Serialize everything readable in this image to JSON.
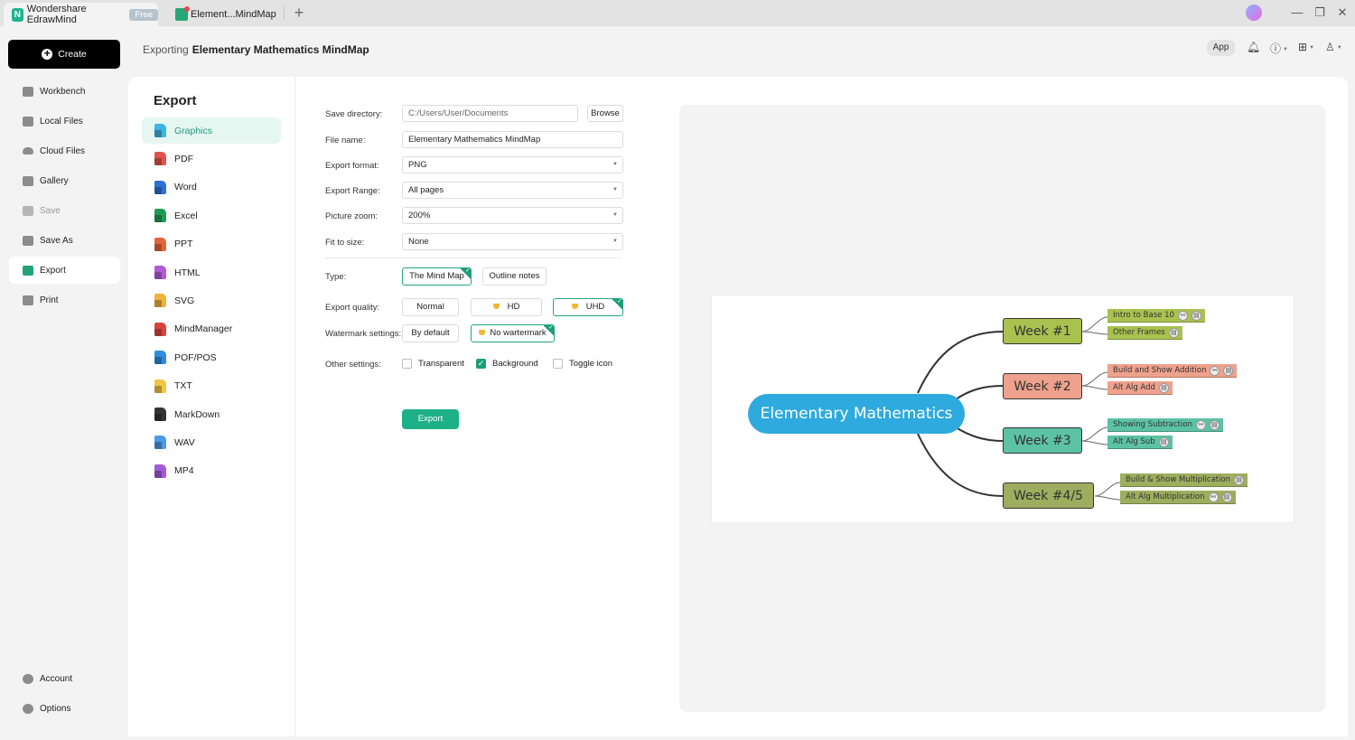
{
  "titlebar": {
    "app_tab": "Wondershare EdrawMind",
    "app_badge": "Free",
    "doc_tab": "Element...MindMap",
    "new_tab_icon": "+",
    "minimize": "—",
    "restore": "❐",
    "close": "✕"
  },
  "sidebar": {
    "create_label": "Create",
    "items": [
      {
        "label": "Workbench",
        "icon": "workbench-icon"
      },
      {
        "label": "Local Files",
        "icon": "folder-icon"
      },
      {
        "label": "Cloud Files",
        "icon": "cloud-icon"
      },
      {
        "label": "Gallery",
        "icon": "gallery-icon"
      },
      {
        "label": "Save",
        "icon": "save-icon"
      },
      {
        "label": "Save As",
        "icon": "save-as-icon"
      },
      {
        "label": "Export",
        "icon": "export-icon"
      },
      {
        "label": "Print",
        "icon": "print-icon"
      }
    ],
    "bottom": [
      {
        "label": "Account",
        "icon": "account-icon"
      },
      {
        "label": "Options",
        "icon": "gear-icon"
      }
    ]
  },
  "header": {
    "prefix": "Exporting",
    "doc_title": "Elementary Mathematics MindMap",
    "app_button": "App",
    "bell": "🔔",
    "help": "?",
    "apps": "⊞",
    "shirt": "👕"
  },
  "export_panel": {
    "heading": "Export",
    "formats": [
      {
        "label": "Graphics",
        "color": "#3db5e0",
        "glyph": ""
      },
      {
        "label": "PDF",
        "color": "#e0534a",
        "glyph": ""
      },
      {
        "label": "Word",
        "color": "#2f6fd1",
        "glyph": "W"
      },
      {
        "label": "Excel",
        "color": "#1f9a54",
        "glyph": "S"
      },
      {
        "label": "PPT",
        "color": "#e3653a",
        "glyph": "P"
      },
      {
        "label": "HTML",
        "color": "#b05ad6",
        "glyph": "H"
      },
      {
        "label": "SVG",
        "color": "#f0b23d",
        "glyph": "S"
      },
      {
        "label": "MindManager",
        "color": "#d6453d",
        "glyph": "M"
      },
      {
        "label": "POF/POS",
        "color": "#2f8be0",
        "glyph": "P"
      },
      {
        "label": "TXT",
        "color": "#f2c542",
        "glyph": ""
      },
      {
        "label": "MarkDown",
        "color": "#333333",
        "glyph": ""
      },
      {
        "label": "WAV",
        "color": "#4a9ae8",
        "glyph": ""
      },
      {
        "label": "MP4",
        "color": "#a15ad9",
        "glyph": ""
      }
    ]
  },
  "form": {
    "save_directory": {
      "label": "Save directory:",
      "value": "C:/Users/User/Documents",
      "browse": "Browse"
    },
    "file_name": {
      "label": "File name:",
      "value": "Elementary Mathematics MindMap"
    },
    "export_format": {
      "label": "Export format:",
      "value": "PNG"
    },
    "export_range": {
      "label": "Export Range:",
      "value": "All pages"
    },
    "picture_zoom": {
      "label": "Picture zoom:",
      "value": "200%"
    },
    "fit_to_size": {
      "label": "Fit to size:",
      "value": "None"
    },
    "type": {
      "label": "Type:",
      "options": [
        "The Mind Map",
        "Outline notes"
      ],
      "selected": "The Mind Map"
    },
    "quality": {
      "label": "Export quality:",
      "options": [
        "Normal",
        "HD",
        "UHD"
      ],
      "selected": "UHD"
    },
    "watermark": {
      "label": "Watermark settings:",
      "options": [
        "By default",
        "No wartermark"
      ],
      "selected": "No wartermark"
    },
    "other": {
      "label": "Other settings:",
      "transparent": "Transparent",
      "background": "Background",
      "toggle_icon": "Toggle icon",
      "transparent_checked": false,
      "background_checked": true,
      "toggle_icon_checked": false
    },
    "export_button": "Export"
  },
  "mindmap": {
    "central": {
      "text": "Elementary Mathematics",
      "color": "#2eaadf"
    },
    "topics": [
      {
        "text": "Week #1",
        "color": "#a9c14f",
        "subs": [
          {
            "text": "Intro to Base 10",
            "link": true
          },
          {
            "text": "Other Frames",
            "link": false
          }
        ]
      },
      {
        "text": "Week #2",
        "color": "#eea18c",
        "subs": [
          {
            "text": "Build and Show Addition",
            "link": true
          },
          {
            "text": "Alt Alg Add",
            "link": false
          }
        ]
      },
      {
        "text": "Week #3",
        "color": "#5cc2a4",
        "subs": [
          {
            "text": "Showing Subtraction",
            "link": true
          },
          {
            "text": "Alt Alg Sub",
            "link": false
          }
        ]
      },
      {
        "text": "Week #4/5",
        "color": "#9fad5e",
        "subs": [
          {
            "text": "Build & Show Multiplication",
            "link": false
          },
          {
            "text": "Alt Alg Multiplication",
            "link": true
          }
        ]
      }
    ]
  }
}
